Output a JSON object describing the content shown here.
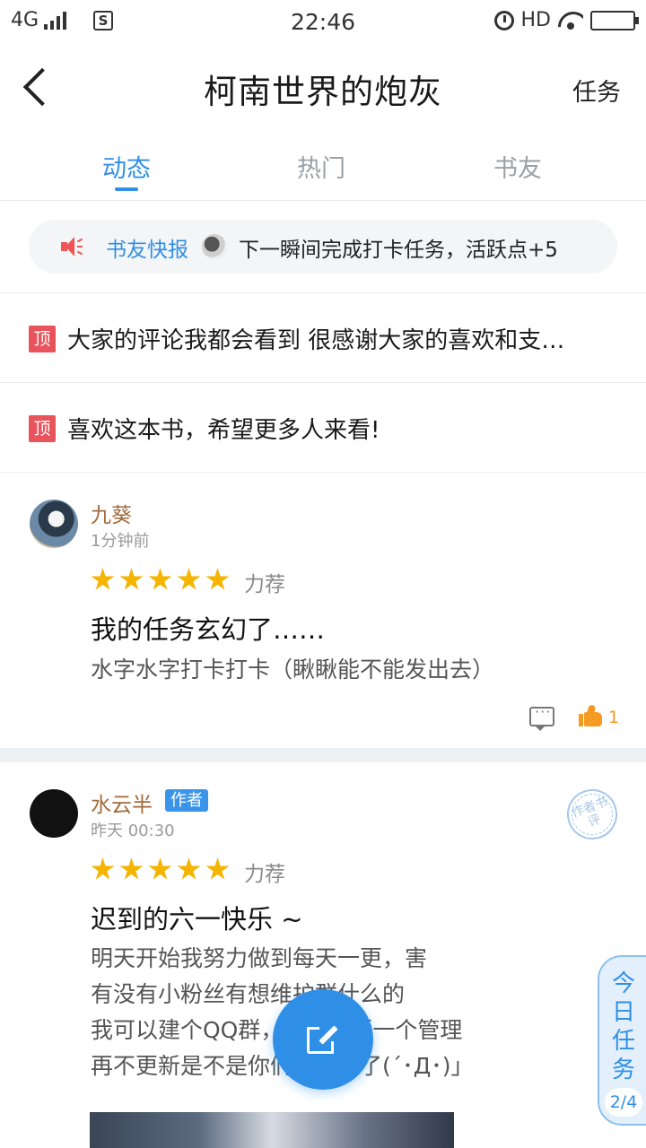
{
  "status_bar": {
    "network": "4G",
    "time": "22:46",
    "hd": "HD",
    "s_icon_label": "S"
  },
  "header": {
    "title": "柯南世界的炮灰",
    "task_label": "任务"
  },
  "tabs": [
    {
      "label": "动态",
      "active": true
    },
    {
      "label": "热门",
      "active": false
    },
    {
      "label": "书友",
      "active": false
    }
  ],
  "notice": {
    "label": "书友快报",
    "text": "下一瞬间完成打卡任务，活跃点+5"
  },
  "pinned": [
    {
      "badge": "顶",
      "text": "大家的评论我都会看到 很感谢大家的喜欢和支…"
    },
    {
      "badge": "顶",
      "text": "喜欢这本书，希望更多人来看!"
    }
  ],
  "posts": [
    {
      "username": "九葵",
      "time": "1分钟前",
      "stars": 5,
      "recommend": "力荐",
      "title": "我的任务玄幻了……",
      "body": [
        "水字水字打卡打卡（瞅瞅能不能发出去）"
      ],
      "like_count": "1"
    },
    {
      "username": "水云半",
      "author_badge": "作者",
      "time": "昨天 00:30",
      "stars": 5,
      "recommend": "力荐",
      "title": "迟到的六一快乐 ~",
      "body": [
        "明天开始我努力做到每天一更，害",
        "有没有小粉丝有想维护群什么的",
        "我可以建个QQ群，因为需要一个管理",
        "再不更新是不是你们要跑掉了(´･Д･)」"
      ],
      "stamp": "作者书评"
    }
  ],
  "daily_task": {
    "label": "今日任务",
    "progress": "2/4"
  },
  "colors": {
    "accent": "#2f8fe6",
    "pin_badge": "#e9535b",
    "star": "#f5b400",
    "username": "#a26a3a",
    "like": "#f59a23"
  }
}
